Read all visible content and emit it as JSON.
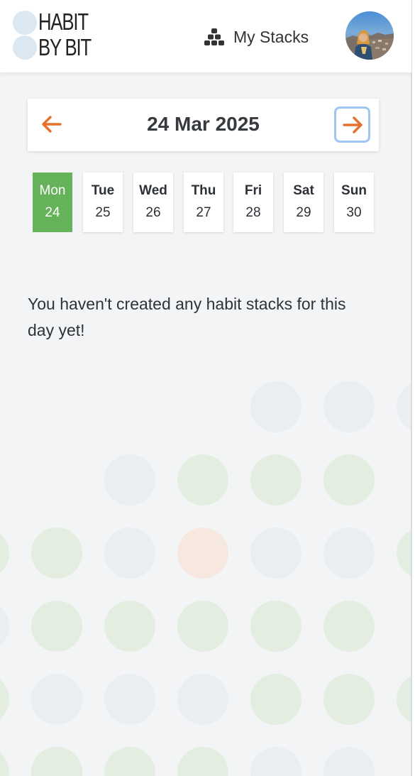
{
  "header": {
    "logo_line1": "HABIT",
    "logo_line2": "BY BIT",
    "nav_label": "My Stacks",
    "nav_icon": "stacks-icon",
    "avatar_icon": "user-avatar"
  },
  "date_nav": {
    "title": "24 Mar 2025",
    "prev_icon": "arrow-left-icon",
    "next_icon": "arrow-right-icon",
    "arrow_color": "#e9702a",
    "focus_color": "#9ec6f4"
  },
  "week": {
    "days": [
      {
        "name": "Mon",
        "num": "24",
        "active": true
      },
      {
        "name": "Tue",
        "num": "25",
        "active": false
      },
      {
        "name": "Wed",
        "num": "26",
        "active": false
      },
      {
        "name": "Thu",
        "num": "27",
        "active": false
      },
      {
        "name": "Fri",
        "num": "28",
        "active": false
      },
      {
        "name": "Sat",
        "num": "29",
        "active": false
      },
      {
        "name": "Sun",
        "num": "30",
        "active": false
      }
    ],
    "active_color": "#66b25b"
  },
  "content": {
    "empty_message": "You haven't created any habit stacks for this day yet!"
  },
  "colors": {
    "background": "#f3f4f6",
    "dot_grey": "#eaedf2",
    "dot_green": "#e3ede0",
    "dot_orange": "#f7e8df"
  }
}
